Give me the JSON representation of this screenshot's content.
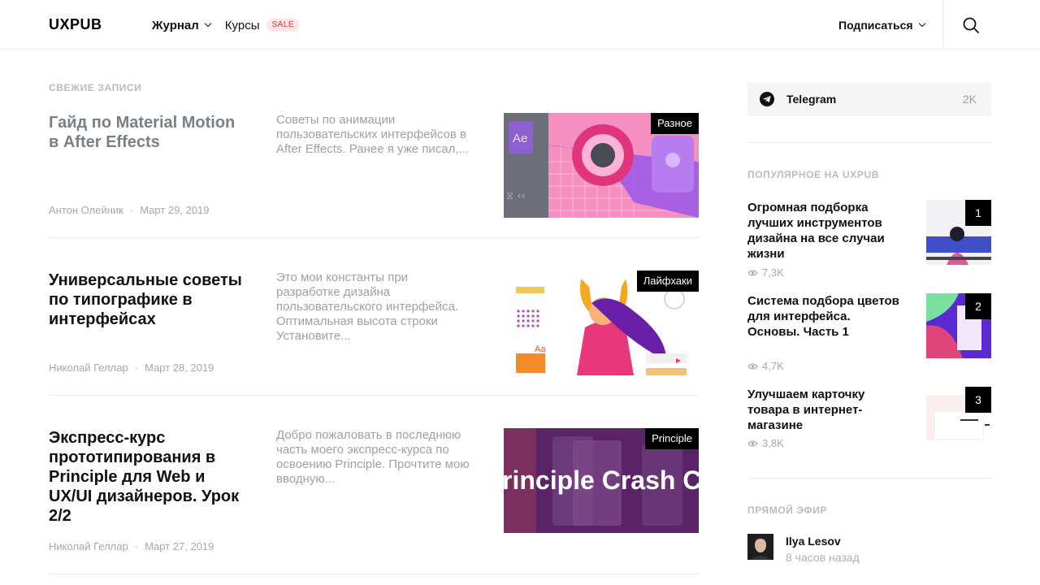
{
  "header": {
    "logo": "UXPUB",
    "nav": [
      {
        "label": "Журнал",
        "active": true,
        "has_dropdown": true
      },
      {
        "label": "Курсы",
        "active": false,
        "badge": "SALE"
      }
    ],
    "subscribe_label": "Подписаться",
    "search_icon": "search-icon"
  },
  "feed": {
    "section_title": "Свежие записи",
    "posts": [
      {
        "title": "Гайд по Material Motion в After Effects",
        "excerpt": "Советы по анимации пользовательских интерфейсов в After Effects. Ранее я уже писал,...",
        "author": "Антон Олейник",
        "date": "Март 29, 2019",
        "tag": "Разное",
        "dot": "·"
      },
      {
        "title": "Универсальные советы по типографике в интерфейсах",
        "excerpt": "Это мои константы при разработке дизайна пользовательского интерфейса. Оптимальная высота строки Установите...",
        "author": "Николай Геллар",
        "date": "Март 28, 2019",
        "tag": "Лайфхаки",
        "dot": "·",
        "thumb_text": "Aa"
      },
      {
        "title": "Экспресс-курс прототипирования в Principle для Web и UX/UI дизайнеров. Урок 2/2",
        "excerpt": "Добро пожаловать в последнюю часть моего экспресс-курса по освоению Principle. Прочтите мою вводную...",
        "author": "Николай Геллар",
        "date": "Март 27, 2019",
        "tag": "Principle",
        "dot": "·",
        "thumb_text": "rinciple Crash C"
      }
    ],
    "first_thumb_text": "Ae"
  },
  "sidebar": {
    "telegram": {
      "label": "Telegram",
      "count": "2K",
      "icon": "telegram-icon"
    },
    "popular_title": "Популярное на UXPUB",
    "popular": [
      {
        "rank": "1",
        "title": "Огромная подборка лучших инструментов дизайна на все случаи жизни",
        "views": "7,3K"
      },
      {
        "rank": "2",
        "title": "Система подбора цветов для интерфейса. Основы. Часть 1",
        "views": "4,7K"
      },
      {
        "rank": "3",
        "title": "Улучшаем карточку товара в интернет-магазине",
        "views": "3,8K"
      }
    ],
    "live_title": "Прямой эфир",
    "live": {
      "name": "Ilya Lesov",
      "time": "8 часов назад"
    }
  },
  "colors": {
    "accent_sale_bg": "#fde8e8",
    "accent_sale_text": "#d23a3a",
    "muted": "#a0a0a0"
  }
}
